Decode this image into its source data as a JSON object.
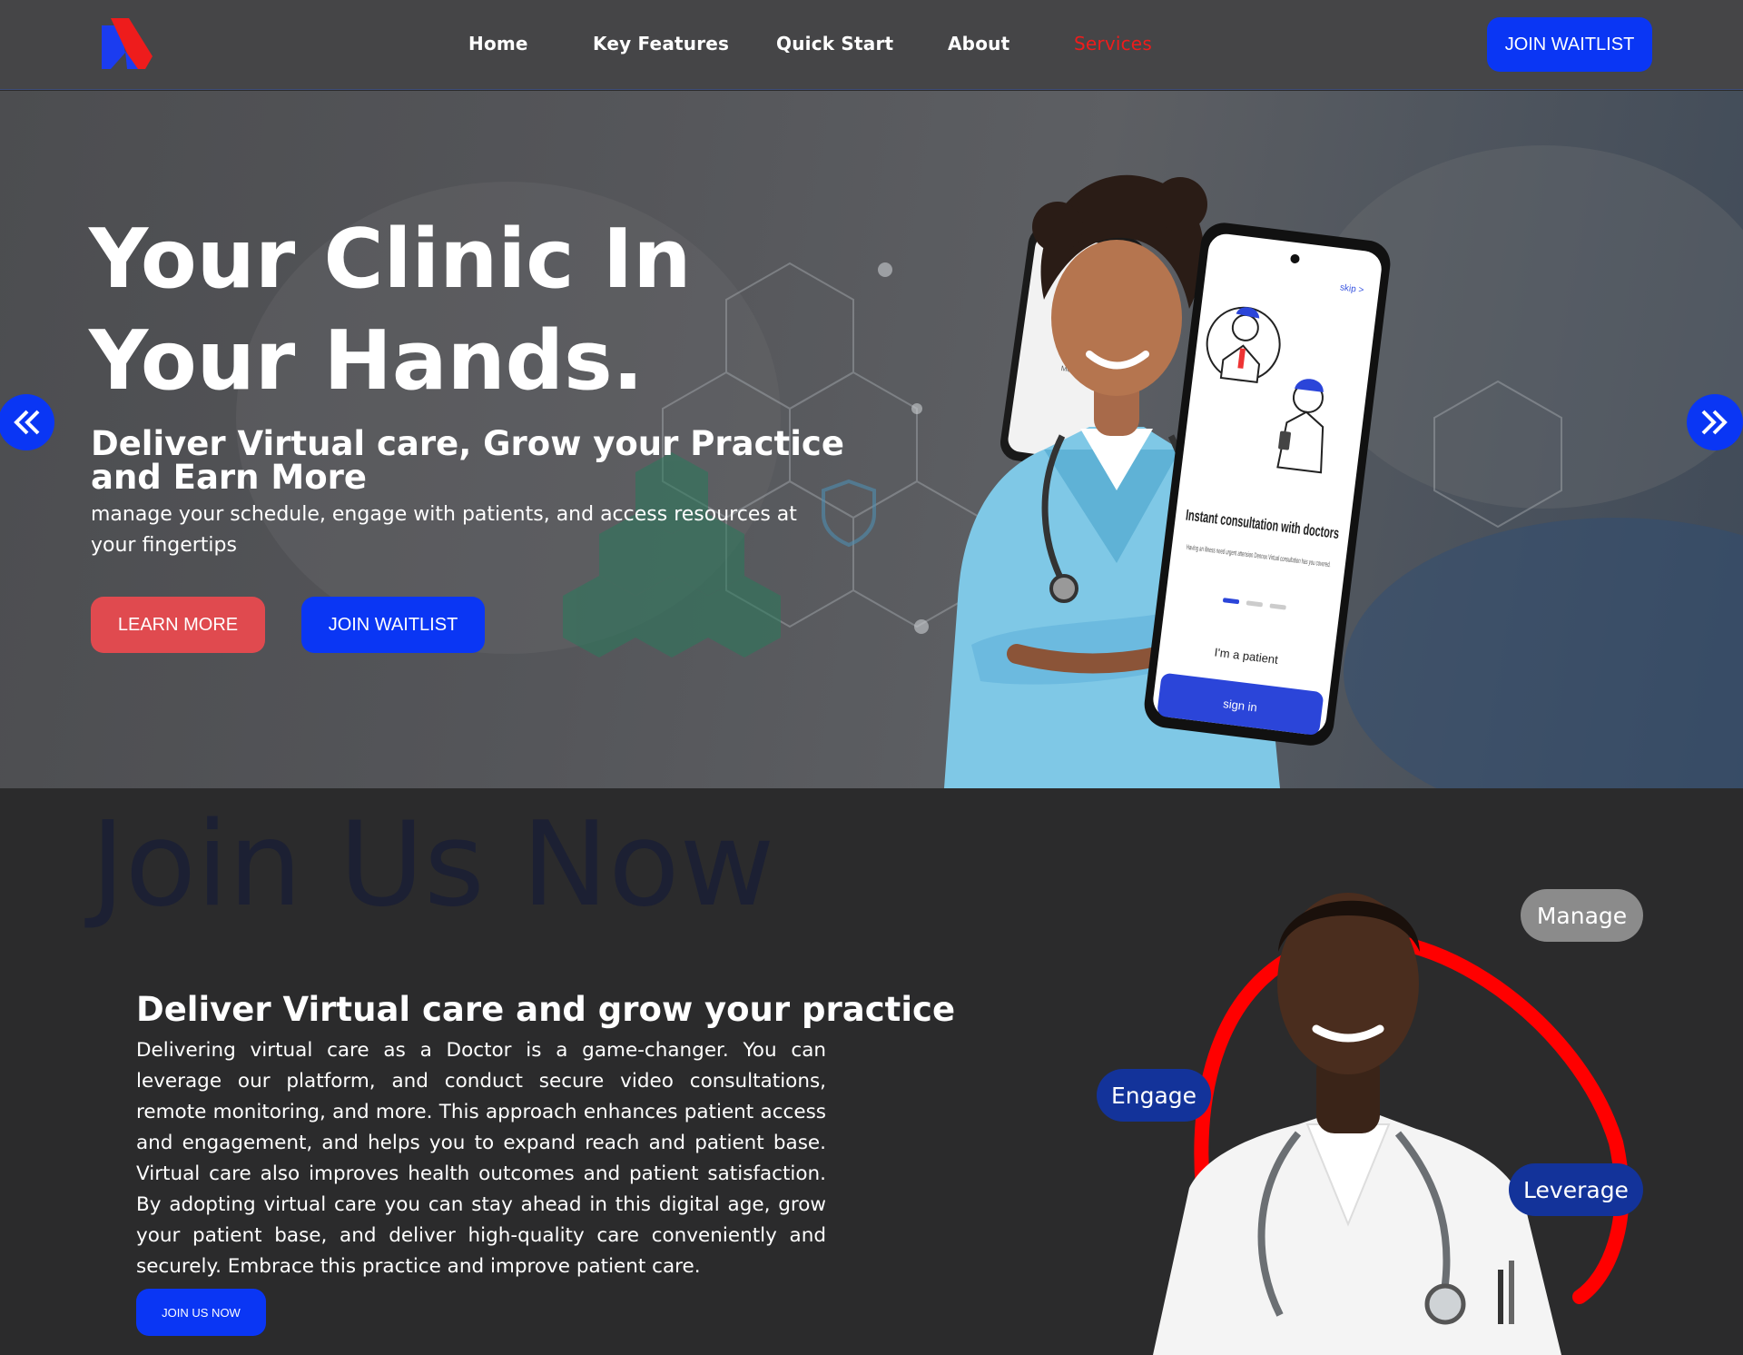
{
  "nav": {
    "logo_icon": "brand-logo-icon",
    "links": [
      {
        "label": "Home"
      },
      {
        "label": "Key Features"
      },
      {
        "label": "Quick Start"
      },
      {
        "label": "About"
      },
      {
        "label": "Services"
      }
    ],
    "active_link": "Services",
    "cta_label": "JOIN WAITLIST"
  },
  "hero": {
    "title": "Your Clinic In Your Hands.",
    "subtitle": "Deliver Virtual care, Grow your Practice and Earn More",
    "description": "manage your schedule, engage with patients, and access resources at your fingertips",
    "learn_more_label": "LEARN MORE",
    "join_label": "JOIN WAITLIST",
    "prev_icon": "double-chevron-left-icon",
    "next_icon": "double-chevron-right-icon",
    "phone": {
      "skip_label": "skip >",
      "heading": "Instant consultation with doctors",
      "body": "Having an illness need urgent attension Dennux Virtual consultation has you covered.",
      "patient_label": "I'm a patient",
      "signin_label": "sign in",
      "back_tag": "Mental Health"
    }
  },
  "join": {
    "watermark": "Join Us Now",
    "heading": "Deliver Virtual care and grow your practice",
    "body": "Delivering virtual care as a Doctor is a game-changer. You can leverage our platform, and conduct secure video consultations, remote monitoring, and more. This approach enhances patient access and engagement, and helps you to expand reach and patient base. Virtual care also improves health outcomes and patient satisfaction. By adopting virtual care you can stay ahead in this digital age, grow your patient base, and deliver high-quality care conveniently and securely. Embrace this practice and improve patient care.",
    "button_label": "JOIN US NOW",
    "pills": {
      "manage": "Manage",
      "engage": "Engage",
      "leverage": "Leverage"
    }
  },
  "colors": {
    "primary_blue": "#0a36f4",
    "accent_red": "#ee1c1c",
    "learn_red": "#e04a4f",
    "pill_blue": "#13339a",
    "pill_gray": "#8b8b8b"
  }
}
